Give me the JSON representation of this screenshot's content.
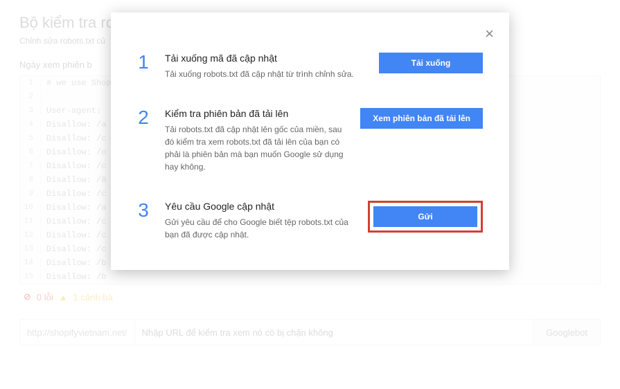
{
  "page": {
    "title": "Bộ kiểm tra robo",
    "subtitle": "Chỉnh sửa robots.txt củ",
    "section_label": "Ngày xem phiên b"
  },
  "editor_lines": [
    "# we use Shop",
    "",
    "User-agent:",
    "Disallow: /a",
    "Disallow: /c",
    "Disallow: /o",
    "Disallow: /c",
    "Disallow: /8",
    "Disallow: /c",
    "Disallow: /a",
    "Disallow: /c",
    "Disallow: /c",
    "Disallow: /c",
    "Disallow: /b",
    "Disallow: /b"
  ],
  "status": {
    "error_count": "0 lỗi",
    "warning_count": "1 cảnh bá"
  },
  "url_test": {
    "prefix": "http://shopifyvietnam.net/",
    "placeholder": "Nhập URL để kiểm tra xem nó có bị chặn không",
    "bot": "Googlebot"
  },
  "modal": {
    "steps": [
      {
        "num": "1",
        "title": "Tải xuống mã đã cập nhật",
        "desc": "Tải xuống robots.txt đã cập nhật từ trình chỉnh sửa.",
        "button": "Tải xuống"
      },
      {
        "num": "2",
        "title": "Kiểm tra phiên bản đã tải lên",
        "desc": "Tải robots.txt đã cập nhật lên gốc của miền, sau đó kiểm tra xem robots.txt đã tải lên của bạn có phải là phiên bản mà bạn muốn Google sử dụng hay không.",
        "button": "Xem phiên bản đã tải lên"
      },
      {
        "num": "3",
        "title": "Yêu cầu Google cập nhật",
        "desc": "Gửi yêu cầu để cho Google biết tệp robots.txt của bạn đã được cập nhật.",
        "button": "Gửi"
      }
    ]
  }
}
